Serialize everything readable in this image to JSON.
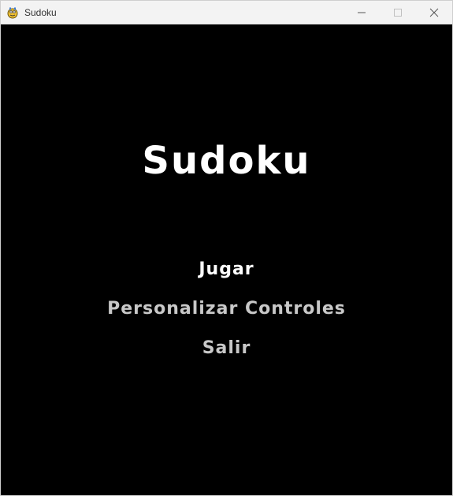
{
  "window": {
    "title": "Sudoku"
  },
  "game": {
    "title": "Sudoku"
  },
  "menu": {
    "items": [
      {
        "label": "Jugar",
        "selected": true,
        "color": "#ffffff"
      },
      {
        "label": "Personalizar Controles",
        "selected": false,
        "color": "#c8c8c8"
      },
      {
        "label": "Salir",
        "selected": false,
        "color": "#c8c8c8"
      }
    ]
  },
  "colors": {
    "background": "#000000",
    "titlebar": "#f3f3f3",
    "selected_text": "#ffffff",
    "unselected_text": "#c8c8c8"
  },
  "icons": {
    "app": "pygame-snake-icon",
    "minimize": "minimize-icon",
    "maximize": "maximize-icon",
    "close": "close-icon"
  }
}
